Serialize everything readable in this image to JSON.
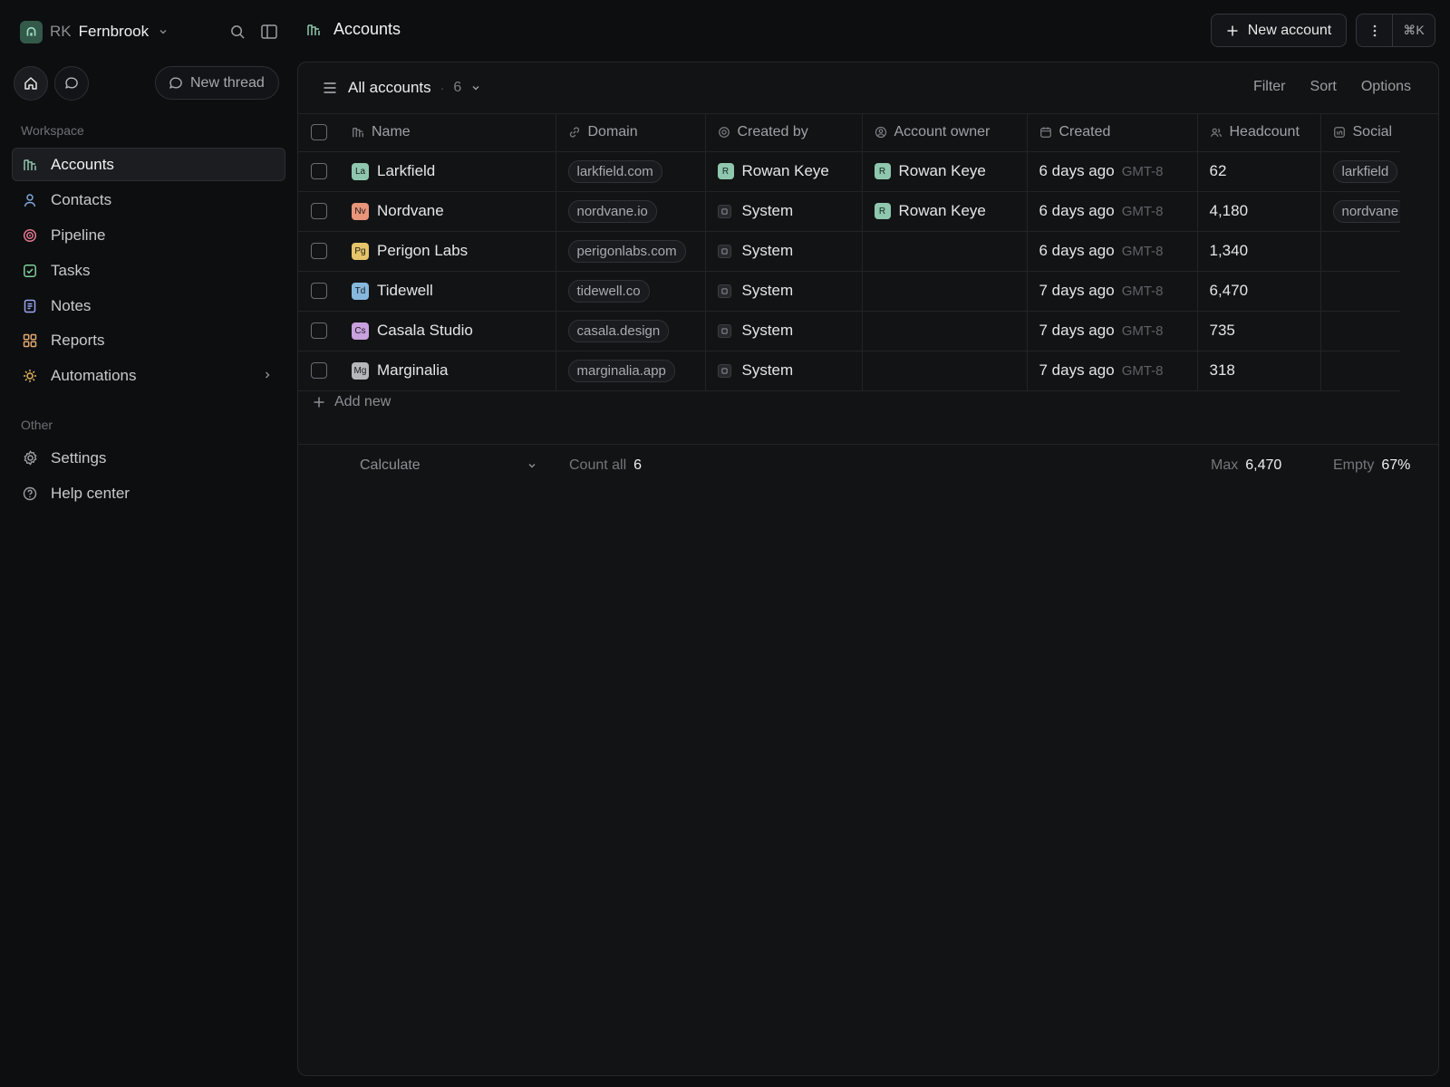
{
  "workspace": {
    "initials": "RK",
    "name": "Fernbrook"
  },
  "sidebar": {
    "new_thread_label": "New thread",
    "sections": {
      "workspace": "Workspace",
      "other": "Other"
    },
    "items": [
      {
        "label": "Accounts",
        "icon": "accounts-icon"
      },
      {
        "label": "Contacts",
        "icon": "person-icon"
      },
      {
        "label": "Pipeline",
        "icon": "target-icon"
      },
      {
        "label": "Tasks",
        "icon": "checkbox-icon"
      },
      {
        "label": "Notes",
        "icon": "note-icon"
      },
      {
        "label": "Reports",
        "icon": "grid-icon"
      },
      {
        "label": "Automations",
        "icon": "sun-icon"
      }
    ],
    "other_items": [
      {
        "label": "Settings",
        "icon": "gear-icon"
      },
      {
        "label": "Help center",
        "icon": "help-icon"
      }
    ]
  },
  "header": {
    "title": "Accounts",
    "new_account_label": "New account",
    "shortcut": "⌘K"
  },
  "view": {
    "name": "All accounts",
    "count": "6",
    "actions": {
      "filter": "Filter",
      "sort": "Sort",
      "options": "Options"
    }
  },
  "table": {
    "columns": {
      "name": "Name",
      "domain": "Domain",
      "created_by": "Created by",
      "owner": "Account owner",
      "created": "Created",
      "headcount": "Headcount",
      "social": "Social"
    },
    "rows": [
      {
        "initials": "La",
        "name": "Larkfield",
        "domain": "larkfield.com",
        "created_by": "Rowan Keye",
        "owner": "Rowan Keye",
        "owner_initial": "R",
        "creator_initial": "R",
        "created": "6 days ago",
        "tz": "GMT-8",
        "headcount": "62",
        "social": "larkfield"
      },
      {
        "initials": "Nv",
        "name": "Nordvane",
        "domain": "nordvane.io",
        "created_by": "System",
        "owner": "Rowan Keye",
        "owner_initial": "R",
        "created": "6 days ago",
        "tz": "GMT-8",
        "headcount": "4,180",
        "social": "nordvane"
      },
      {
        "initials": "Pg",
        "name": "Perigon Labs",
        "domain": "perigonlabs.com",
        "created_by": "System",
        "created": "6 days ago",
        "tz": "GMT-8",
        "headcount": "1,340"
      },
      {
        "initials": "Td",
        "name": "Tidewell",
        "domain": "tidewell.co",
        "created_by": "System",
        "created": "7 days ago",
        "tz": "GMT-8",
        "headcount": "6,470"
      },
      {
        "initials": "Cs",
        "name": "Casala Studio",
        "domain": "casala.design",
        "created_by": "System",
        "created": "7 days ago",
        "tz": "GMT-8",
        "headcount": "735"
      },
      {
        "initials": "Mg",
        "name": "Marginalia",
        "domain": "marginalia.app",
        "created_by": "System",
        "created": "7 days ago",
        "tz": "GMT-8",
        "headcount": "318"
      }
    ],
    "add_new_label": "Add new"
  },
  "footer": {
    "calculate_label": "Calculate",
    "count_label": "Count all",
    "count_value": "6",
    "max_label": "Max",
    "max_value": "6,470",
    "empty_label": "Empty",
    "empty_value": "67%"
  },
  "colors": {
    "accent": "#8fc7ae",
    "logo_larkfield": "#8fc7ae",
    "logo_nordvane": "#e8957a",
    "logo_perigon": "#e6c46a",
    "logo_tidewell": "#86b8de",
    "logo_casala": "#c9a1de",
    "logo_marginalia": "#b5b7bb"
  }
}
